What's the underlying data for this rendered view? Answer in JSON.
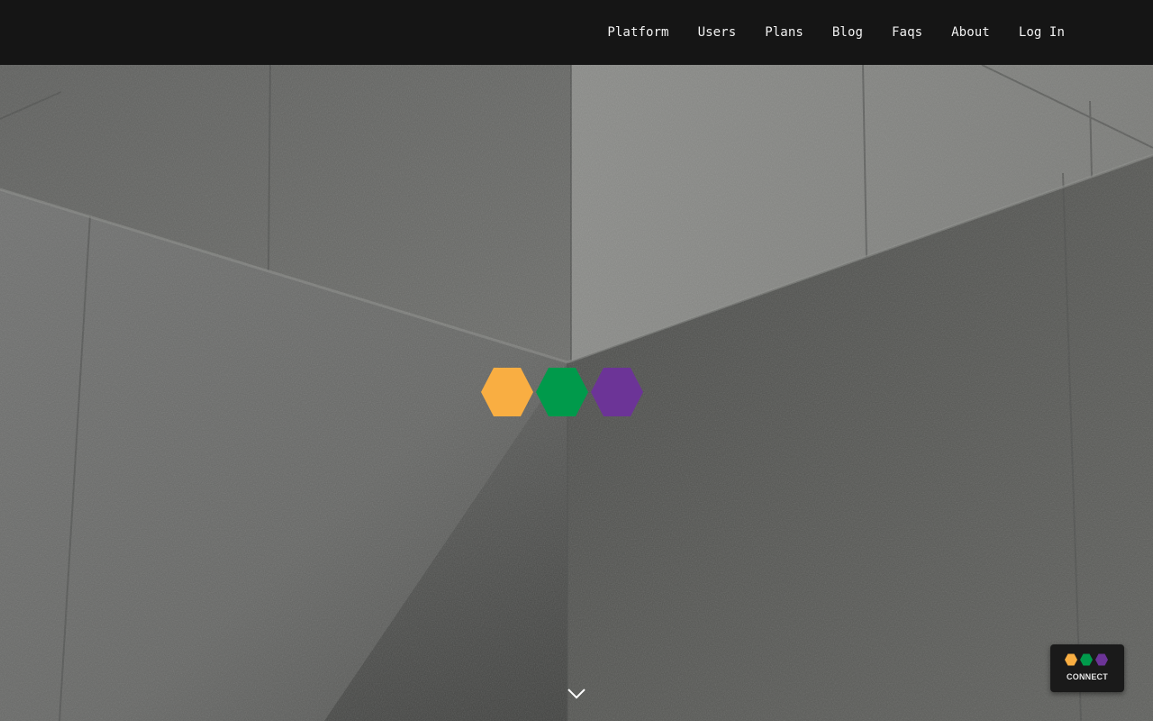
{
  "nav": {
    "items": [
      {
        "label": "Platform"
      },
      {
        "label": "Users"
      },
      {
        "label": "Plans"
      },
      {
        "label": "Blog"
      },
      {
        "label": "Faqs"
      },
      {
        "label": "About"
      },
      {
        "label": "Log In"
      }
    ]
  },
  "hero": {
    "background": "concrete-walls-photo",
    "logo_icon": "three-hexagons-logo",
    "scroll_icon": "chevron-down-icon"
  },
  "brand_colors": {
    "hex_orange": "#F9AE42",
    "hex_green": "#009A4B",
    "hex_purple": "#6C3497",
    "header_bg": "#151515"
  },
  "connect_widget": {
    "label": "CONNECT",
    "icon": "three-hexagons-logo"
  }
}
